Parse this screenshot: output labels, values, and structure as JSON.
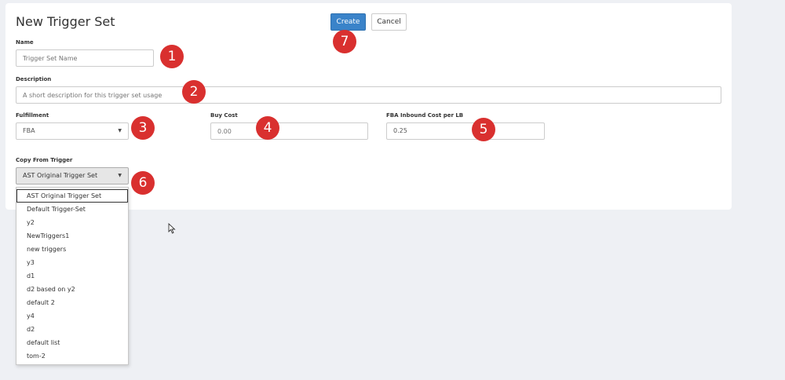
{
  "page": {
    "title": "New Trigger Set"
  },
  "toolbar": {
    "create_label": "Create",
    "cancel_label": "Cancel"
  },
  "form": {
    "name": {
      "label": "Name",
      "placeholder": "Trigger Set Name"
    },
    "description": {
      "label": "Description",
      "placeholder": "A short description for this trigger set usage"
    },
    "fulfillment": {
      "label": "Fulfillment",
      "value": "FBA"
    },
    "buy_cost": {
      "label": "Buy Cost",
      "placeholder": "0.00"
    },
    "fba_inbound": {
      "label": "FBA Inbound Cost per LB",
      "value": "0.25"
    },
    "copy_from": {
      "label": "Copy From Trigger",
      "value": "AST Original Trigger Set",
      "options": [
        "AST Original Trigger Set",
        "Default Trigger-Set",
        "y2",
        "NewTriggers1",
        "new triggers",
        "y3",
        "d1",
        "d2 based on y2",
        "default 2",
        "y4",
        "d2",
        "default list",
        "tom-2"
      ]
    }
  },
  "badges": [
    "1",
    "2",
    "3",
    "4",
    "5",
    "6",
    "7"
  ],
  "colors": {
    "primary": "#3a83c9",
    "badge": "#d9302f",
    "background": "#eef0f4"
  }
}
